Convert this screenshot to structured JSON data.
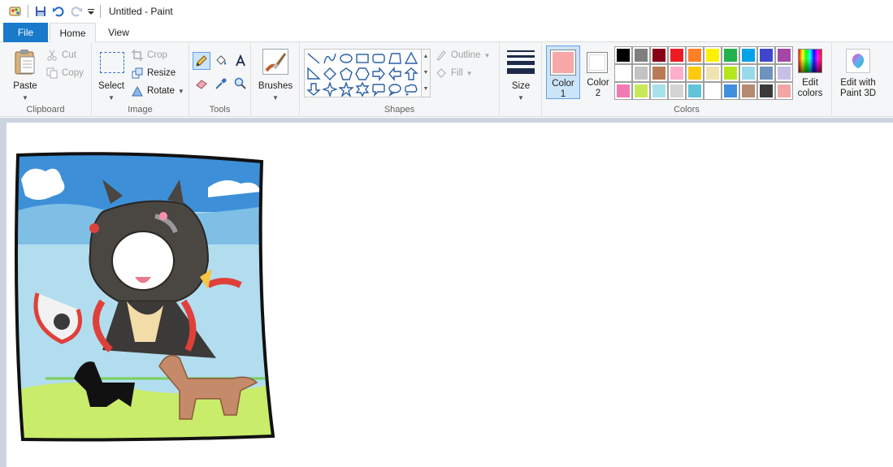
{
  "window": {
    "title": "Untitled - Paint"
  },
  "tabs": {
    "file": "File",
    "home": "Home",
    "view": "View"
  },
  "clipboard": {
    "paste": "Paste",
    "cut": "Cut",
    "copy": "Copy",
    "label": "Clipboard"
  },
  "image": {
    "select": "Select",
    "crop": "Crop",
    "resize": "Resize",
    "rotate": "Rotate",
    "label": "Image"
  },
  "tools": {
    "label": "Tools"
  },
  "brushes": {
    "label": "Brushes"
  },
  "shapes": {
    "outline": "Outline",
    "fill": "Fill",
    "label": "Shapes"
  },
  "size": {
    "label": "Size"
  },
  "colors": {
    "color1_label": "Color",
    "color1_num": "1",
    "color2_label": "Color",
    "color2_num": "2",
    "edit_label": "Edit",
    "edit_label2": "colors",
    "group_label": "Colors",
    "color1_value": "#f7a7a7",
    "color2_value": "#ffffff",
    "palette_row1": [
      "#000000",
      "#7f7f7f",
      "#880015",
      "#ed1c24",
      "#ff7f27",
      "#fff200",
      "#22b14c",
      "#00a2e8",
      "#3f48cc",
      "#a349a4"
    ],
    "palette_row2": [
      "#ffffff",
      "#c3c3c3",
      "#b97a57",
      "#ffaec9",
      "#ffc90e",
      "#efe4b0",
      "#b5e61d",
      "#99d9ea",
      "#7092be",
      "#c8bfe7"
    ],
    "palette_row3": [
      "#f07bb4",
      "#c8e85a",
      "#a8e0ec",
      "#d4d4d4",
      "#5fc4d8",
      "#ffffff",
      "#3f8fdc",
      "#b48a72",
      "#3a3a3a",
      "#f4a6a6"
    ]
  },
  "paint3d": {
    "line1": "Edit with",
    "line2": "Paint 3D"
  }
}
